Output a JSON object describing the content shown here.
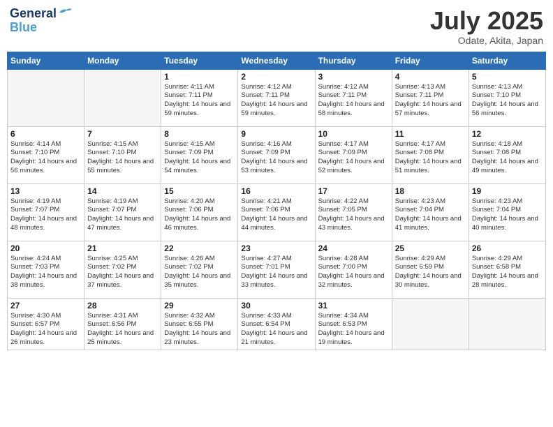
{
  "header": {
    "logo_line1": "General",
    "logo_line2": "Blue",
    "month": "July 2025",
    "location": "Odate, Akita, Japan"
  },
  "weekdays": [
    "Sunday",
    "Monday",
    "Tuesday",
    "Wednesday",
    "Thursday",
    "Friday",
    "Saturday"
  ],
  "weeks": [
    [
      {
        "day": "",
        "text": ""
      },
      {
        "day": "",
        "text": ""
      },
      {
        "day": "1",
        "text": "Sunrise: 4:11 AM\nSunset: 7:11 PM\nDaylight: 14 hours and 59 minutes."
      },
      {
        "day": "2",
        "text": "Sunrise: 4:12 AM\nSunset: 7:11 PM\nDaylight: 14 hours and 59 minutes."
      },
      {
        "day": "3",
        "text": "Sunrise: 4:12 AM\nSunset: 7:11 PM\nDaylight: 14 hours and 58 minutes."
      },
      {
        "day": "4",
        "text": "Sunrise: 4:13 AM\nSunset: 7:11 PM\nDaylight: 14 hours and 57 minutes."
      },
      {
        "day": "5",
        "text": "Sunrise: 4:13 AM\nSunset: 7:10 PM\nDaylight: 14 hours and 56 minutes."
      }
    ],
    [
      {
        "day": "6",
        "text": "Sunrise: 4:14 AM\nSunset: 7:10 PM\nDaylight: 14 hours and 56 minutes."
      },
      {
        "day": "7",
        "text": "Sunrise: 4:15 AM\nSunset: 7:10 PM\nDaylight: 14 hours and 55 minutes."
      },
      {
        "day": "8",
        "text": "Sunrise: 4:15 AM\nSunset: 7:09 PM\nDaylight: 14 hours and 54 minutes."
      },
      {
        "day": "9",
        "text": "Sunrise: 4:16 AM\nSunset: 7:09 PM\nDaylight: 14 hours and 53 minutes."
      },
      {
        "day": "10",
        "text": "Sunrise: 4:17 AM\nSunset: 7:09 PM\nDaylight: 14 hours and 52 minutes."
      },
      {
        "day": "11",
        "text": "Sunrise: 4:17 AM\nSunset: 7:08 PM\nDaylight: 14 hours and 51 minutes."
      },
      {
        "day": "12",
        "text": "Sunrise: 4:18 AM\nSunset: 7:08 PM\nDaylight: 14 hours and 49 minutes."
      }
    ],
    [
      {
        "day": "13",
        "text": "Sunrise: 4:19 AM\nSunset: 7:07 PM\nDaylight: 14 hours and 48 minutes."
      },
      {
        "day": "14",
        "text": "Sunrise: 4:19 AM\nSunset: 7:07 PM\nDaylight: 14 hours and 47 minutes."
      },
      {
        "day": "15",
        "text": "Sunrise: 4:20 AM\nSunset: 7:06 PM\nDaylight: 14 hours and 46 minutes."
      },
      {
        "day": "16",
        "text": "Sunrise: 4:21 AM\nSunset: 7:06 PM\nDaylight: 14 hours and 44 minutes."
      },
      {
        "day": "17",
        "text": "Sunrise: 4:22 AM\nSunset: 7:05 PM\nDaylight: 14 hours and 43 minutes."
      },
      {
        "day": "18",
        "text": "Sunrise: 4:23 AM\nSunset: 7:04 PM\nDaylight: 14 hours and 41 minutes."
      },
      {
        "day": "19",
        "text": "Sunrise: 4:23 AM\nSunset: 7:04 PM\nDaylight: 14 hours and 40 minutes."
      }
    ],
    [
      {
        "day": "20",
        "text": "Sunrise: 4:24 AM\nSunset: 7:03 PM\nDaylight: 14 hours and 38 minutes."
      },
      {
        "day": "21",
        "text": "Sunrise: 4:25 AM\nSunset: 7:02 PM\nDaylight: 14 hours and 37 minutes."
      },
      {
        "day": "22",
        "text": "Sunrise: 4:26 AM\nSunset: 7:02 PM\nDaylight: 14 hours and 35 minutes."
      },
      {
        "day": "23",
        "text": "Sunrise: 4:27 AM\nSunset: 7:01 PM\nDaylight: 14 hours and 33 minutes."
      },
      {
        "day": "24",
        "text": "Sunrise: 4:28 AM\nSunset: 7:00 PM\nDaylight: 14 hours and 32 minutes."
      },
      {
        "day": "25",
        "text": "Sunrise: 4:29 AM\nSunset: 6:59 PM\nDaylight: 14 hours and 30 minutes."
      },
      {
        "day": "26",
        "text": "Sunrise: 4:29 AM\nSunset: 6:58 PM\nDaylight: 14 hours and 28 minutes."
      }
    ],
    [
      {
        "day": "27",
        "text": "Sunrise: 4:30 AM\nSunset: 6:57 PM\nDaylight: 14 hours and 26 minutes."
      },
      {
        "day": "28",
        "text": "Sunrise: 4:31 AM\nSunset: 6:56 PM\nDaylight: 14 hours and 25 minutes."
      },
      {
        "day": "29",
        "text": "Sunrise: 4:32 AM\nSunset: 6:55 PM\nDaylight: 14 hours and 23 minutes."
      },
      {
        "day": "30",
        "text": "Sunrise: 4:33 AM\nSunset: 6:54 PM\nDaylight: 14 hours and 21 minutes."
      },
      {
        "day": "31",
        "text": "Sunrise: 4:34 AM\nSunset: 6:53 PM\nDaylight: 14 hours and 19 minutes."
      },
      {
        "day": "",
        "text": ""
      },
      {
        "day": "",
        "text": ""
      }
    ]
  ]
}
